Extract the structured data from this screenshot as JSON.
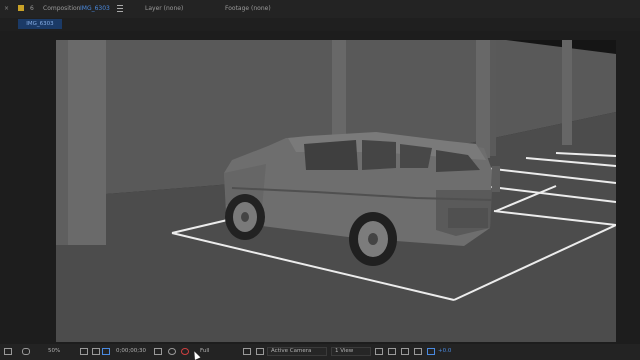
{
  "tabs": {
    "close": "×",
    "number": "6",
    "composition_prefix": "Composition",
    "composition_name": "IMG_6303",
    "layer": "Layer (none)",
    "footage": "Footage (none)"
  },
  "subtab": {
    "label": "IMG_6303"
  },
  "bottom": {
    "zoom": "50%",
    "timecode": "0;00;00;30",
    "resolution": "Full",
    "camera": "Active Camera",
    "views": "1 View",
    "exposure": "+0.0"
  },
  "colors": {
    "accent": "#4a8ae0",
    "viewer_bg": "#2b2b2b"
  }
}
